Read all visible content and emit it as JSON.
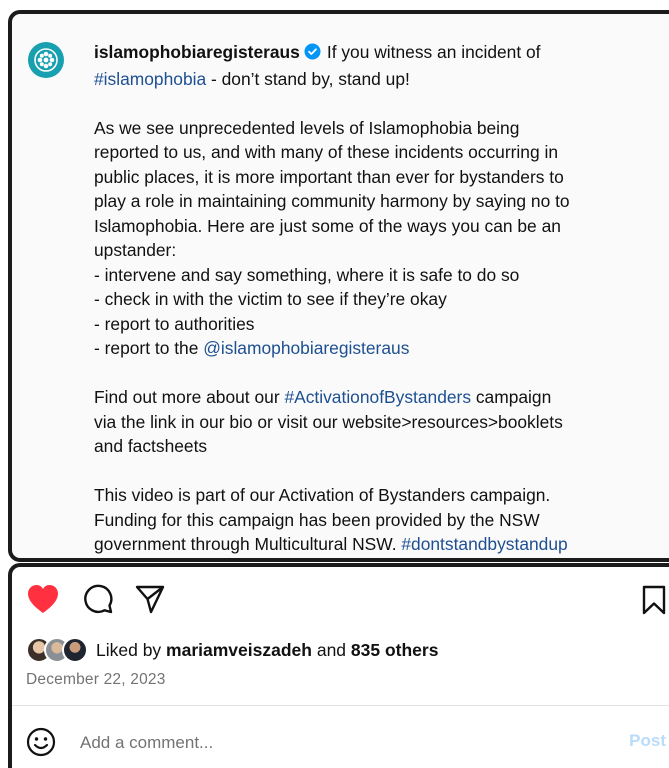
{
  "post": {
    "username": "islamophobiaregisteraus",
    "icons": {
      "avatar": "flower-logo-icon",
      "verified": "verified-badge-icon"
    },
    "colors": {
      "avatar_bg": "#18a0b0",
      "verified": "#0095f6",
      "hashtag": "#1d4f91",
      "like": "#ff3040"
    },
    "caption": {
      "p1_intro": "If you witness an incident of",
      "p1_tag": "#islamophobia",
      "p1_end": " - don’t stand by, stand up!",
      "p2_lines": [
        "As we see unprecedented levels of Islamophobia being",
        "reported to us, and with many of these incidents occurring in",
        "public places, it is more important than ever for bystanders to",
        "play a role in maintaining community harmony by saying no to",
        "Islamophobia. Here are just some of the ways you can be an",
        "upstander:",
        "- intervene and say something, where it is safe to do so",
        "- check in with the victim to see if they’re okay",
        "- report to authorities"
      ],
      "p2_last_prefix": "- report to the ",
      "p2_last_mention": "@islamophobiaregisteraus",
      "p3_prefix": "Find out more about our ",
      "p3_tag": "#ActivationofBystanders",
      "p3_suffix": " campaign",
      "p3_lines": [
        "via the link in our bio or visit our website>resources>booklets",
        "and factsheets"
      ],
      "p4_lines": [
        "This video is part of our Activation of Bystanders campaign.",
        "Funding for this campaign has been provided by the NSW"
      ],
      "p4_last_prefix": "government through Multicultural NSW. ",
      "p4_last_tag": "#dontstandbystandup"
    }
  },
  "actions": {
    "icons": [
      "heart-filled-icon",
      "comment-icon",
      "share-icon",
      "bookmark-icon"
    ],
    "liked": true
  },
  "likes": {
    "prefix": "Liked by ",
    "user": "mariamveiszadeh",
    "middle": " and ",
    "others": "835 others"
  },
  "date": "December 22, 2023",
  "comment": {
    "placeholder": "Add a comment...",
    "post_label": "Post",
    "emoji_icon": "smiley-icon"
  }
}
